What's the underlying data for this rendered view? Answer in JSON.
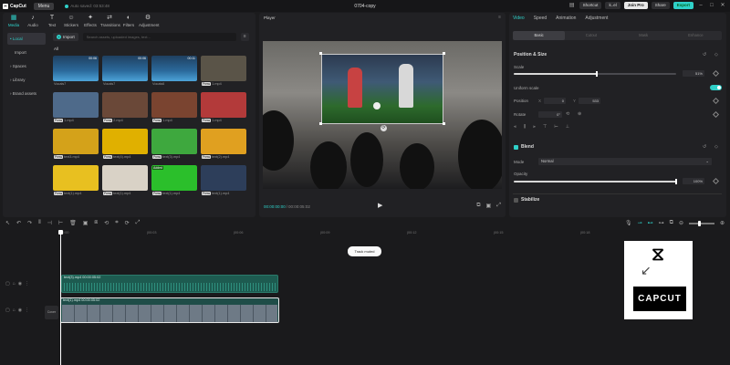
{
  "topbar": {
    "app_name": "CapCut",
    "menu_label": "Menu",
    "autosave_text": "Auto saved: 03:53:48",
    "project_title": "0704-copy",
    "shortcut_label": "Shortcut",
    "user_label": "k..el",
    "pro_label": "Join Pro",
    "share_label": "Share",
    "export_label": "Export"
  },
  "media_panel": {
    "tools": [
      {
        "label": "Media",
        "icon": "media-icon",
        "active": true
      },
      {
        "label": "Audio",
        "icon": "audio-icon"
      },
      {
        "label": "Text",
        "icon": "text-icon"
      },
      {
        "label": "Stickers",
        "icon": "stickers-icon"
      },
      {
        "label": "Effects",
        "icon": "effects-icon"
      },
      {
        "label": "Transitions",
        "icon": "transitions-icon"
      },
      {
        "label": "Filters",
        "icon": "filters-icon"
      },
      {
        "label": "Adjustment",
        "icon": "adjustment-icon"
      }
    ],
    "sidebar": [
      {
        "label": "• Local",
        "active": true
      },
      {
        "label": "Import"
      },
      {
        "label": "› Spaces"
      },
      {
        "label": "› Library"
      },
      {
        "label": "› Brand assets"
      }
    ],
    "import_label": "Import",
    "search_placeholder": "Search assets, uploaded images, text...",
    "all_label": "All",
    "thumbnails": [
      {
        "caption": "Vocals7",
        "duration": "00:06",
        "kind": "audio",
        "color": "#2b6a9c"
      },
      {
        "caption": "Vocals7",
        "duration": "00:06",
        "kind": "audio",
        "color": "#2b6a9c"
      },
      {
        "caption": "Vocals6",
        "duration": "00:11",
        "kind": "audio",
        "color": "#2b6a9c"
      },
      {
        "caption": "1.mp4",
        "tag": "Press",
        "kind": "video",
        "color": "#5a5448"
      },
      {
        "caption": "1.mp4",
        "tag": "Press",
        "kind": "video",
        "color": "#4e6a8a"
      },
      {
        "caption": "2.mp4",
        "tag": "Press",
        "kind": "video",
        "color": "#6a4838"
      },
      {
        "caption": "1.mp4",
        "tag": "Press",
        "kind": "video",
        "color": "#7a4430"
      },
      {
        "caption": "1.mp4",
        "tag": "Press",
        "kind": "video",
        "color": "#b33a3a"
      },
      {
        "caption": "text3.mp4",
        "tag": "Press",
        "kind": "video",
        "color": "#d4a21a"
      },
      {
        "caption": "text(4).mp4",
        "tag": "Press",
        "kind": "video",
        "color": "#e0b000"
      },
      {
        "caption": "text(3).mp4",
        "tag": "Press",
        "kind": "video",
        "color": "#3ea83e"
      },
      {
        "caption": "text(2).mp4",
        "tag": "Press",
        "kind": "video",
        "color": "#e0a020"
      },
      {
        "caption": "text(1).mp4",
        "tag": "Press",
        "kind": "video",
        "color": "#e8c020"
      },
      {
        "caption": "text(1).mp4",
        "tag": "Press",
        "kind": "video",
        "color": "#d9d2c6"
      },
      {
        "caption": "text(1).mp4",
        "tag": "Press",
        "kind": "video",
        "color": "#2bbf2b",
        "added": "Added"
      },
      {
        "caption": "text(1).mp4",
        "tag": "Press",
        "kind": "video",
        "color": "#2d3e5a"
      }
    ]
  },
  "player": {
    "title": "Player",
    "time_current": "00:00:00:00",
    "time_total": "00:00:05:02"
  },
  "properties": {
    "tabs": [
      {
        "label": "Video",
        "active": true
      },
      {
        "label": "Speed"
      },
      {
        "label": "Animation"
      },
      {
        "label": "Adjustment"
      }
    ],
    "subtabs": [
      {
        "label": "Basic",
        "active": true
      },
      {
        "label": "Cutout"
      },
      {
        "label": "Mask"
      },
      {
        "label": "Enhance"
      }
    ],
    "position_size_title": "Position & Size",
    "scale_label": "Scale",
    "scale_value": "51%",
    "scale_fraction": 0.51,
    "uniform_scale_label": "Uniform scale",
    "position_label": "Position",
    "position_x": "0",
    "position_y": "533",
    "rotate_label": "Rotate",
    "rotate_value": "0°",
    "blend_title": "Blend",
    "mode_label": "Mode",
    "mode_value": "Normal",
    "opacity_label": "Opacity",
    "opacity_value": "100%",
    "opacity_fraction": 1.0,
    "stabilize_label": "Stabilize"
  },
  "timeline": {
    "toast": "Track muted",
    "ruler_ticks": [
      "00:00",
      "|00:03",
      "|00:06",
      "|00:09",
      "|00:12",
      "|00:15",
      "|00:18"
    ],
    "track1_label": "text(3).mp4  00:00:05:02",
    "track2_label": "text(1).mp4  00:00:05:02",
    "cover_label": "Cover"
  },
  "capcut_card": {
    "brand": "CAPCUT"
  }
}
